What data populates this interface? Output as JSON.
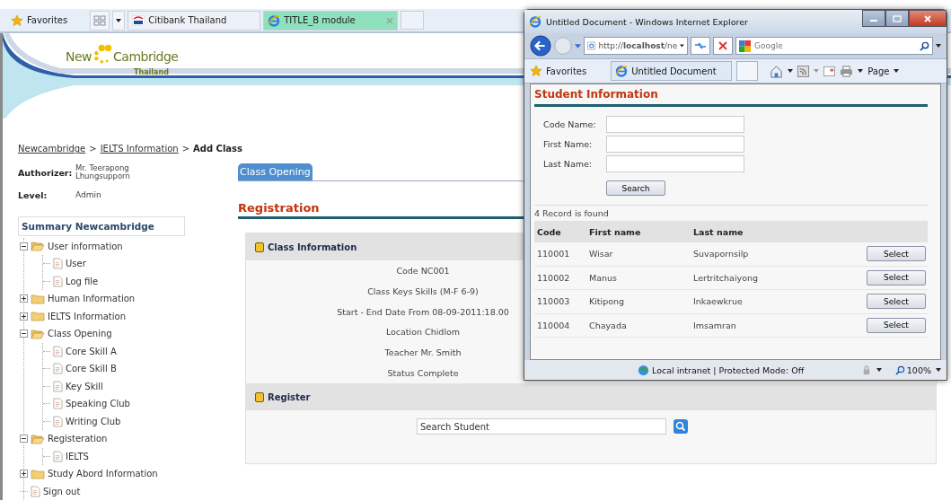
{
  "browser": {
    "favorites": "Favorites",
    "tabs": [
      {
        "label": "Citibank Thailand",
        "selected": false
      },
      {
        "label": "TITLE_B module",
        "selected": true
      }
    ]
  },
  "logo": {
    "word_1": "New",
    "word_2": "Cambridge",
    "tagline": "Thailand"
  },
  "breadcrumb": [
    {
      "label": "Newcambridge",
      "link": true
    },
    {
      "label": ">",
      "link": false
    },
    {
      "label": "IELTS Information",
      "link": true
    },
    {
      "label": ">",
      "link": false
    },
    {
      "label": "Add Class",
      "link": false
    }
  ],
  "user": {
    "authorizer_label": "Authorizer:",
    "authorizer": "Mr. Teerapong Lhungsupporn",
    "level_label": "Level:",
    "level": "Admin"
  },
  "sidebar": {
    "title": "Summary Newcambridge",
    "tree": [
      {
        "label": "User information",
        "kind": "folder",
        "expanded": true,
        "children": [
          {
            "label": "User",
            "kind": "page"
          },
          {
            "label": "Log file",
            "kind": "page"
          }
        ]
      },
      {
        "label": "Human Information",
        "kind": "folder",
        "expanded": false
      },
      {
        "label": "IELTS Information",
        "kind": "folder",
        "expanded": false
      },
      {
        "label": "Class Opening",
        "kind": "folder",
        "expanded": true,
        "children": [
          {
            "label": "Core Skill A",
            "kind": "page"
          },
          {
            "label": "Core Skill B",
            "kind": "page"
          },
          {
            "label": "Key Skill",
            "kind": "page"
          },
          {
            "label": "Speaking Club",
            "kind": "page"
          },
          {
            "label": "Writing Club",
            "kind": "page"
          }
        ]
      },
      {
        "label": "Registeration",
        "kind": "folder",
        "expanded": true,
        "children": [
          {
            "label": "IELTS",
            "kind": "page"
          }
        ]
      },
      {
        "label": "Study Abord Information",
        "kind": "folder",
        "expanded": false
      },
      {
        "label": "Sign out",
        "kind": "page"
      }
    ]
  },
  "content": {
    "tab": "Class Opening",
    "heading": "Registration",
    "class_info": {
      "title": "Class Information",
      "rows": [
        "Code NC001",
        "Class Keys Skills (M-F 6-9)",
        "Start - End Date From 08-09-2011:18.00",
        "Location Chidlom",
        "Teacher Mr. Smith",
        "Status Complete"
      ]
    },
    "register": {
      "title": "Register",
      "search_value": "Search Student"
    }
  },
  "popup": {
    "title": "Untitled Document - Windows Internet Explorer",
    "address": "http://**localhost**/ne",
    "search_placeholder": "Google",
    "favorites": "Favorites",
    "tab": "Untitled Document",
    "page_menu": "Page",
    "heading": "Student Information",
    "fields": [
      {
        "label": "Code Name:"
      },
      {
        "label": "First Name:"
      },
      {
        "label": "Last Name:"
      }
    ],
    "search_button": "Search",
    "result": "4 Record is found",
    "columns": [
      "Code",
      "First name",
      "Last name"
    ],
    "rows": [
      {
        "code": "110001",
        "first": "Wisar",
        "last": "Suvapornsilp",
        "action": "Select"
      },
      {
        "code": "110002",
        "first": "Manus",
        "last": "Lertritchaiyong",
        "action": "Select"
      },
      {
        "code": "110003",
        "first": "Kitipong",
        "last": "Inkaewkrue",
        "action": "Select"
      },
      {
        "code": "110004",
        "first": "Chayada",
        "last": "Imsamran",
        "action": "Select"
      }
    ],
    "status": "Local intranet | Protected Mode: Off",
    "zoom": "100%"
  }
}
